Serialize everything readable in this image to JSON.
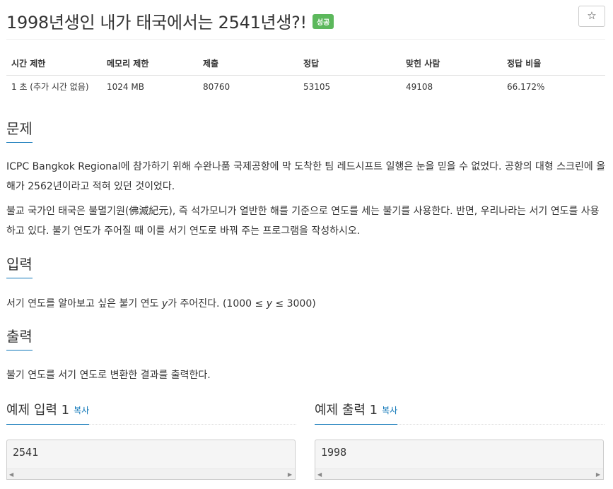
{
  "problem": {
    "title": "1998년생인 내가 태국에서는 2541년생?!",
    "badge": "성공",
    "star": "☆"
  },
  "info_table": {
    "headers": [
      "시간 제한",
      "메모리 제한",
      "제출",
      "정답",
      "맞힌 사람",
      "정답 비율"
    ],
    "values": [
      "1 초 (추가 시간 없음)",
      "1024 MB",
      "80760",
      "53105",
      "49108",
      "66.172%"
    ]
  },
  "sections": {
    "description": {
      "heading": "문제",
      "paragraphs": [
        "ICPC Bangkok Regional에 참가하기 위해 수완나품 국제공항에 막 도착한 팀 레드시프트 일행은 눈을 믿을 수 없었다. 공항의 대형 스크린에 올해가 2562년이라고 적혀 있던 것이었다.",
        "불교 국가인 태국은 불멸기원(佛滅紀元), 즉 석가모니가 열반한 해를 기준으로 연도를 세는 불기를 사용한다. 반면, 우리나라는 서기 연도를 사용하고 있다. 불기 연도가 주어질 때 이를 서기 연도로 바꿔 주는 프로그램을 작성하시오."
      ]
    },
    "input": {
      "heading": "입력",
      "text_before": "서기 연도를 알아보고 싶은 불기 연도 ",
      "var1": "y",
      "text_mid": "가 주어진다. (1000 ≤ ",
      "var2": "y",
      "text_after": " ≤ 3000)"
    },
    "output": {
      "heading": "출력",
      "text": "불기 연도를 서기 연도로 변환한 결과를 출력한다."
    }
  },
  "examples": {
    "input": {
      "title": "예제 입력 1",
      "copy": "복사",
      "value": "2541"
    },
    "output": {
      "title": "예제 출력 1",
      "copy": "복사",
      "value": "1998"
    }
  },
  "scroll": {
    "left": "◀",
    "right": "▶"
  }
}
